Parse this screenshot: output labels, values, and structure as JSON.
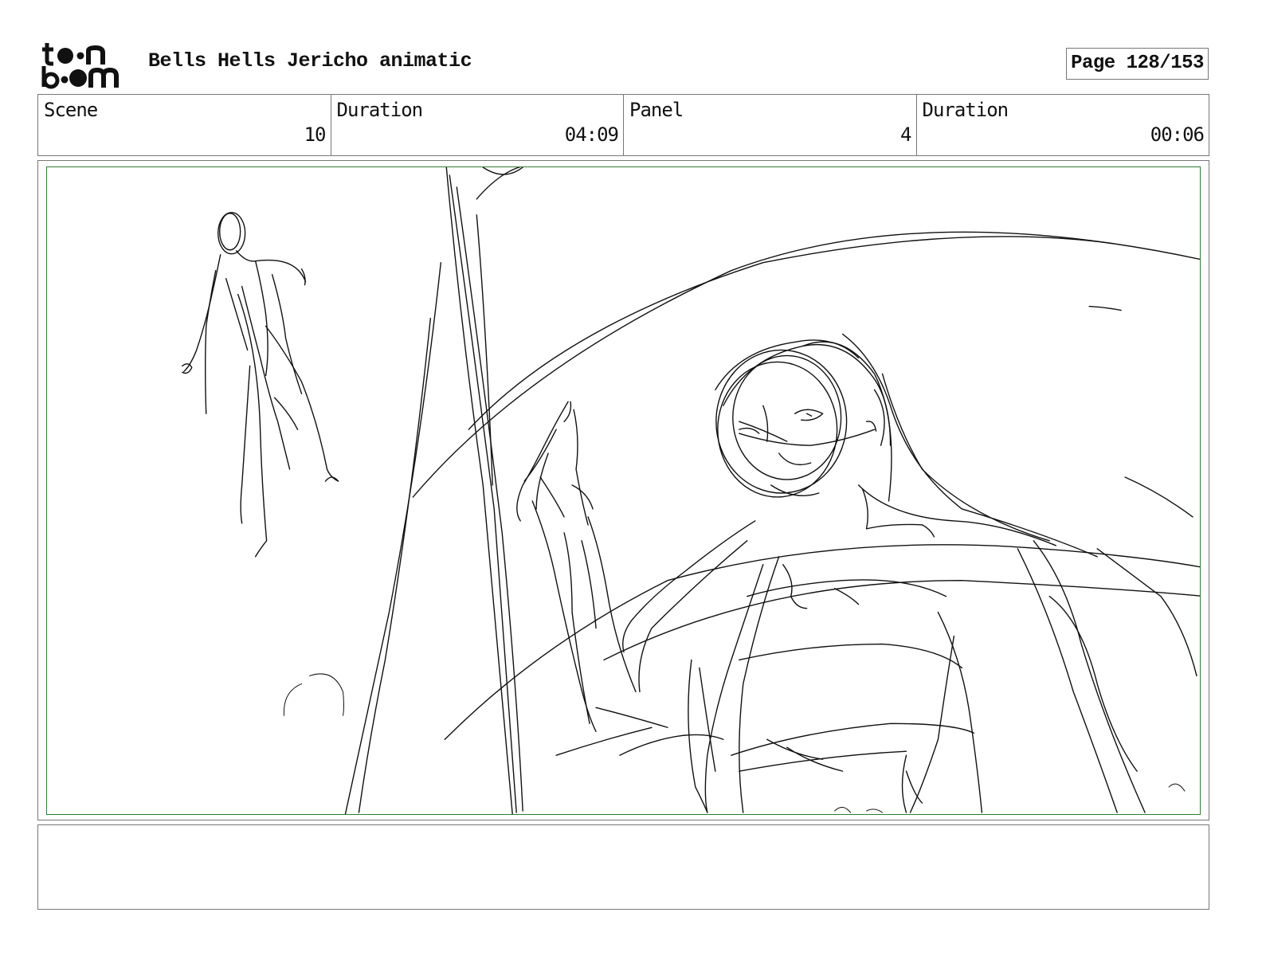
{
  "header": {
    "title": "Bells Hells Jericho animatic",
    "page_label": "Page 128/153",
    "logo": {
      "line1": "toon",
      "line2": "boom"
    }
  },
  "info": {
    "scene_label": "Scene",
    "scene_value": "10",
    "scene_duration_label": "Duration",
    "scene_duration_value": "04:09",
    "panel_label": "Panel",
    "panel_value": "4",
    "panel_duration_label": "Duration",
    "panel_duration_value": "00:06"
  },
  "notes": {
    "text": ""
  },
  "colors": {
    "frame_border": "#777777",
    "panel_border": "#2e7d32",
    "ink": "#111111"
  }
}
